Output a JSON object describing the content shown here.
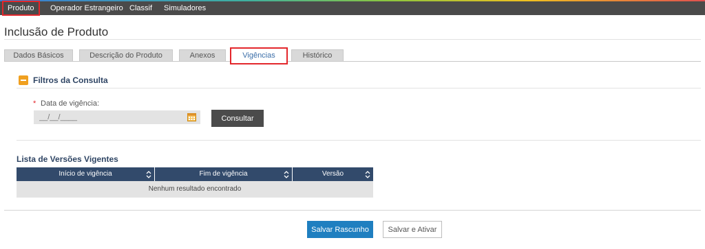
{
  "topnav": {
    "items": [
      {
        "label": "Produto"
      },
      {
        "label": "Operador Estrangeiro"
      },
      {
        "label": "Classif"
      },
      {
        "label": "Simuladores"
      }
    ]
  },
  "page": {
    "title": "Inclusão de Produto"
  },
  "tabs": [
    {
      "label": "Dados Básicos"
    },
    {
      "label": "Descrição do Produto"
    },
    {
      "label": "Anexos"
    },
    {
      "label": "Vigências"
    },
    {
      "label": "Histórico"
    }
  ],
  "filters": {
    "title": "Filtros da Consulta",
    "required_marker": "*",
    "date_label": "Data de vigência:",
    "date_placeholder": "__/__/____",
    "submit_label": "Consultar"
  },
  "results": {
    "title": "Lista de Versões Vigentes",
    "columns": [
      {
        "label": "Início de vigência"
      },
      {
        "label": "Fim de vigência"
      },
      {
        "label": "Versão"
      }
    ],
    "empty_message": "Nenhum resultado encontrado"
  },
  "actions": {
    "save_draft": "Salvar Rascunho",
    "save_activate": "Salvar e Ativar"
  },
  "colors": {
    "topbar": "#4a4a4a",
    "highlight": "#e3262b",
    "table_header": "#324a6b",
    "primary_button": "#1f7fc0",
    "section_toggle": "#f0a020"
  }
}
